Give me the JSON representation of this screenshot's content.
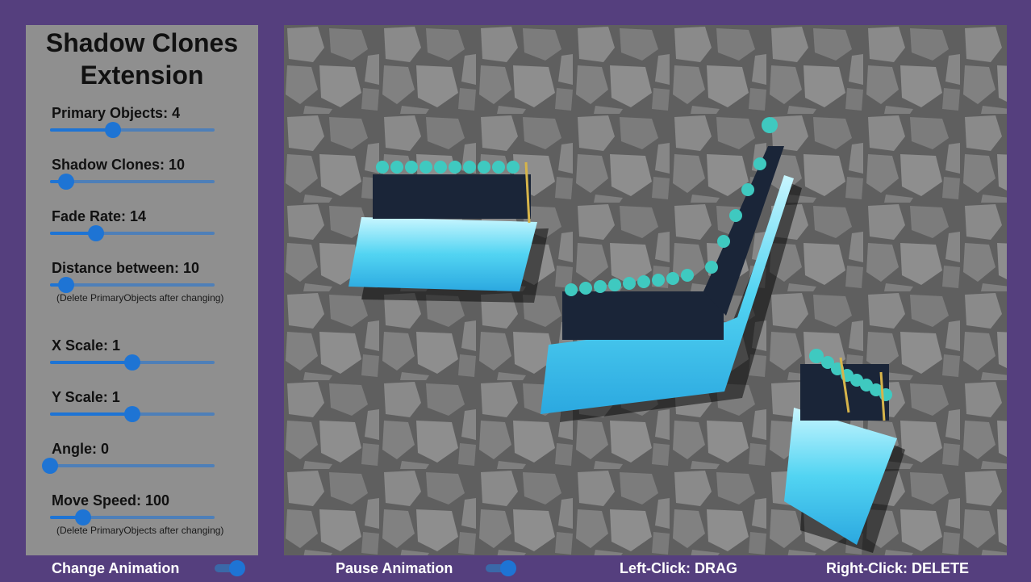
{
  "panel": {
    "title_line1": "Shadow Clones",
    "title_line2": "Extension",
    "controls": [
      {
        "label": "Primary Objects: 4",
        "value_fraction": 0.38
      },
      {
        "label": "Shadow Clones: 10",
        "value_fraction": 0.1
      },
      {
        "label": "Fade Rate: 14",
        "value_fraction": 0.28
      },
      {
        "label": "Distance between: 10",
        "value_fraction": 0.1,
        "note": "(Delete PrimaryObjects after changing)"
      },
      {
        "label": "X Scale: 1",
        "value_fraction": 0.5
      },
      {
        "label": "Y Scale: 1",
        "value_fraction": 0.5
      },
      {
        "label": "Angle: 0",
        "value_fraction": 0.0
      },
      {
        "label": "Move Speed: 100",
        "value_fraction": 0.2,
        "note": "(Delete PrimaryObjects after changing)"
      }
    ]
  },
  "footer": {
    "change_animation": "Change Animation",
    "change_animation_on": true,
    "pause_animation": "Pause Animation",
    "pause_animation_on": true,
    "left_click": "Left-Click: DRAG",
    "right_click": "Right-Click: DELETE"
  },
  "colors": {
    "background": "#553f7e",
    "panel": "#8f8f8f",
    "accent": "#1e74d4",
    "clone_teal": "#3fc9c0",
    "wave": "#58d6f0"
  },
  "stage": {
    "groups": [
      {
        "name": "clone-group-1",
        "clones": 10
      },
      {
        "name": "clone-group-2",
        "clones": 10
      },
      {
        "name": "clone-group-3",
        "clones": 10
      }
    ]
  }
}
